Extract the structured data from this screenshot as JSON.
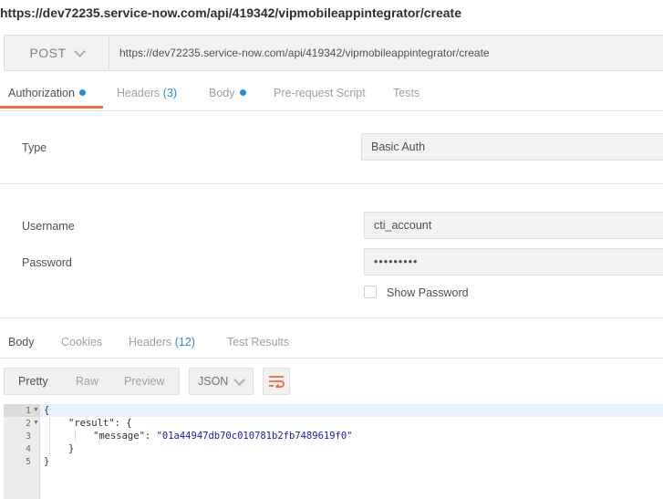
{
  "title_url": "https://dev72235.service-now.com/api/419342/vipmobileappintegrator/create",
  "request": {
    "method": "POST",
    "url": "https://dev72235.service-now.com/api/419342/vipmobileappintegrator/create"
  },
  "request_tabs": [
    {
      "label": "Authorization",
      "active": true,
      "dot": true
    },
    {
      "label": "Headers",
      "count": "(3)"
    },
    {
      "label": "Body",
      "dot": true
    },
    {
      "label": "Pre-request Script"
    },
    {
      "label": "Tests"
    }
  ],
  "auth": {
    "type_label": "Type",
    "type_value": "Basic Auth",
    "username_label": "Username",
    "username_value": "cti_account",
    "password_label": "Password",
    "password_value": "•••••••••",
    "show_password_label": "Show Password"
  },
  "response_tabs": [
    {
      "label": "Body",
      "active": true
    },
    {
      "label": "Cookies"
    },
    {
      "label": "Headers",
      "count": "(12)"
    },
    {
      "label": "Test Results"
    }
  ],
  "view_modes": [
    "Pretty",
    "Raw",
    "Preview"
  ],
  "format": "JSON",
  "icons": {
    "method_dropdown": "chevron-down-icon",
    "format_dropdown": "chevron-down-icon",
    "wrap": "wrap-lines-icon",
    "fold": "fold-arrow-icon"
  },
  "colors": {
    "accent": "#f26b3a",
    "indicator": "#2f86d6",
    "string": "#1a1aa6"
  },
  "code": {
    "line_numbers": [
      "1",
      "2",
      "3",
      "4",
      "5"
    ],
    "lines": [
      {
        "text": "{"
      },
      {
        "text": "\"result\": {"
      },
      {
        "key": "\"message\"",
        "sep": ": ",
        "value": "\"01a44947db70c010781b2fb7489619f0\""
      },
      {
        "text": "}"
      },
      {
        "text": "}"
      }
    ]
  }
}
